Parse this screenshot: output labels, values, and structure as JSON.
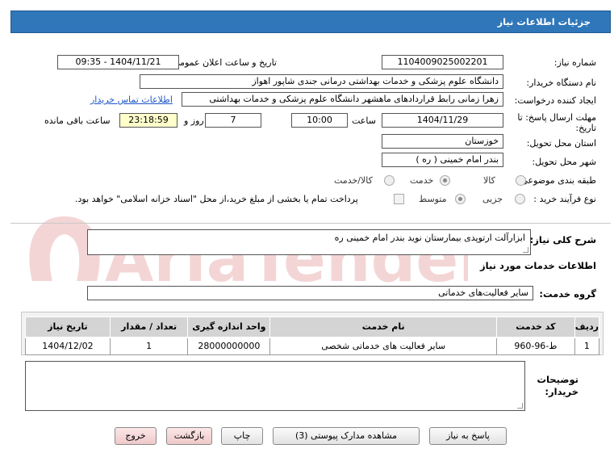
{
  "header": {
    "title": "جزئیات اطلاعات نیاز"
  },
  "form": {
    "need_number": {
      "label": "شماره نیاز:",
      "value": "1104009025002201"
    },
    "announce": {
      "label": "تاریخ و ساعت اعلان عمومی:",
      "value": "1404/11/21 - 09:35"
    },
    "buyer": {
      "label": "نام دستگاه خریدار:",
      "value": "دانشگاه علوم پزشکی و خدمات بهداشتی درمانی جندی شاپور اهواز"
    },
    "requester": {
      "label": "ایجاد کننده درخواست:",
      "value": "زهرا زمانی رابط قراردادهای ماهشهر دانشگاه علوم پزشکی و خدمات بهداشتی",
      "contact_link": "اطلاعات تماس خریدار"
    },
    "deadline": {
      "label_line1": "مهلت ارسال پاسخ: تا",
      "label_line2": "تاریخ:",
      "date": "1404/11/29",
      "time_label": "ساعت",
      "time": "10:00",
      "days": "7",
      "days_label": "روز و",
      "remaining": "23:18:59",
      "remaining_label": "ساعت باقی مانده"
    },
    "province": {
      "label": "استان محل تحویل:",
      "value": "خوزستان"
    },
    "city": {
      "label": "شهر محل تحویل:",
      "value": "بندر امام خمینی ( ره )"
    },
    "category": {
      "label": "طبقه بندی موضوعی:",
      "options": [
        "کالا",
        "خدمت",
        "کالا/خدمت"
      ],
      "selected": "خدمت"
    },
    "purchase_type": {
      "label": "نوع فرآیند خرید :",
      "options": [
        "جزیی",
        "متوسط"
      ],
      "selected": "متوسط",
      "payment_note": "پرداخت تمام یا بخشی از مبلغ خرید،از محل \"اسناد خزانه اسلامی\" خواهد بود."
    }
  },
  "summary": {
    "label": "شرح کلی نیاز:",
    "value": "ابزارآلت ارتوپدی بیمارستان نوید بندر امام خمینی ره"
  },
  "services_section": {
    "title": "اطلاعات خدمات مورد نیاز",
    "group_label": "گروه خدمت:",
    "group_value": "سایر فعالیت‌های خدماتی",
    "columns": [
      "ردیف",
      "کد خدمت",
      "نام خدمت",
      "واحد اندازه گیری",
      "تعداد / مقدار",
      "تاریخ نیاز"
    ],
    "rows": [
      {
        "row": "1",
        "code": "ط-96-960",
        "name": "سایر فعالیت های خدماتی شخصی",
        "unit": "28000000000",
        "qty": "1",
        "date": "1404/12/02"
      }
    ]
  },
  "buyer_notes": {
    "label_line1": "توضیحات",
    "label_line2": "خریدار:",
    "value": ""
  },
  "buttons": {
    "reply": "پاسخ به نیاز",
    "attachments": "مشاهده مدارک پیوستی (3)",
    "print": "چاپ",
    "back": "بازگشت",
    "exit": "خروج"
  },
  "watermark": {
    "text": "AriaTender.net"
  },
  "colors": {
    "titlebar": "#2f77b9",
    "link": "#1e57c7",
    "remaining_bg": "#ffffcc",
    "table_header": "#d4d4d4"
  }
}
